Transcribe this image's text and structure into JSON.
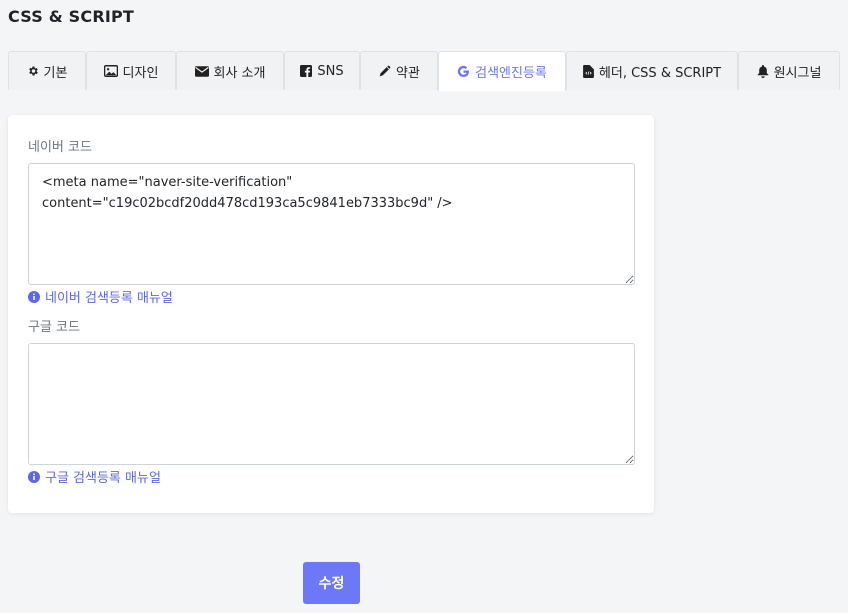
{
  "page": {
    "title": "CSS & SCRIPT"
  },
  "tabs": [
    {
      "label": "기본",
      "icon": "gear-icon"
    },
    {
      "label": "디자인",
      "icon": "image-icon"
    },
    {
      "label": "회사 소개",
      "icon": "envelope-icon"
    },
    {
      "label": "SNS",
      "icon": "facebook-icon"
    },
    {
      "label": "약관",
      "icon": "pen-icon"
    },
    {
      "label": "검색엔진등록",
      "icon": "google-icon"
    },
    {
      "label": "헤더, CSS & SCRIPT",
      "icon": "file-code-icon"
    },
    {
      "label": "원시그널",
      "icon": "bell-icon"
    }
  ],
  "active_tab": "검색엔진등록",
  "naver": {
    "label": "네이버 코드",
    "value": "<meta name=\"naver-site-verification\"\ncontent=\"c19c02bcdf20dd478cd193ca5c9841eb7333bc9d\" />\n",
    "help": "네이버 검색등록 매뉴얼"
  },
  "google": {
    "label": "구글 코드",
    "value": "",
    "help": "구글 검색등록 매뉴얼"
  },
  "submit_label": "수정",
  "colors": {
    "accent": "#6c78f5",
    "link": "#5d68e8",
    "active_tab_text": "#6c78f0",
    "background": "#f4f5f7"
  }
}
